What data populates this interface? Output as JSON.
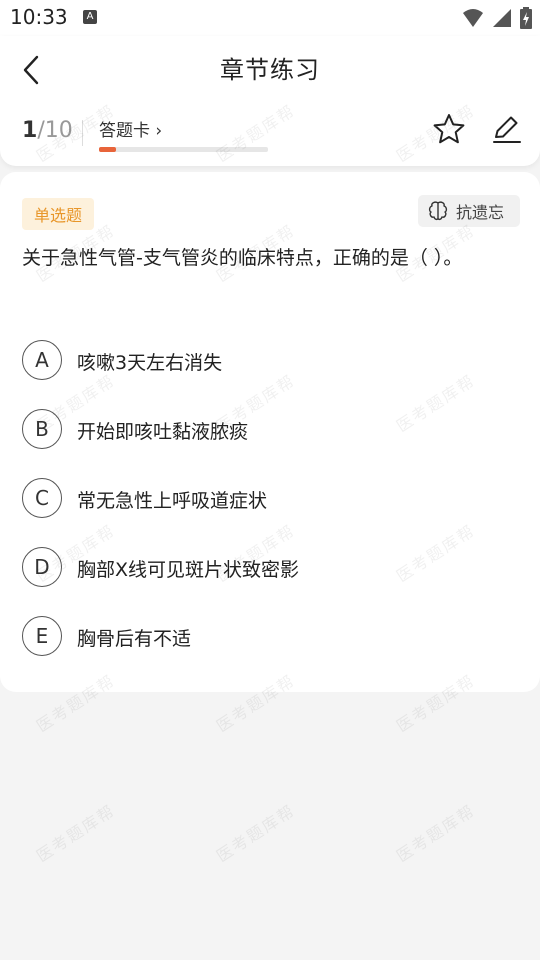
{
  "status_bar": {
    "time": "10:33",
    "notif_letter": "A"
  },
  "header": {
    "title": "章节练习",
    "progress": {
      "current": "1",
      "total": "/10",
      "fraction": 0.1
    },
    "answer_card_label": "答题卡",
    "answer_card_chevron": "›"
  },
  "question": {
    "type_label": "单选题",
    "memory_button_label": "抗遗忘",
    "text": "关于急性气管-支气管炎的临床特点，正确的是（ ）。",
    "options": [
      {
        "letter": "A",
        "text": "咳嗽3天左右消失"
      },
      {
        "letter": "B",
        "text": "开始即咳吐黏液脓痰"
      },
      {
        "letter": "C",
        "text": "常无急性上呼吸道症状"
      },
      {
        "letter": "D",
        "text": "胸部X线可见斑片状致密影"
      },
      {
        "letter": "E",
        "text": "胸骨后有不适"
      }
    ]
  },
  "watermark_text": "医考题库帮",
  "colors": {
    "accent": "#e8643a",
    "tag_bg": "#fdf1dc",
    "tag_text": "#e8962a"
  }
}
